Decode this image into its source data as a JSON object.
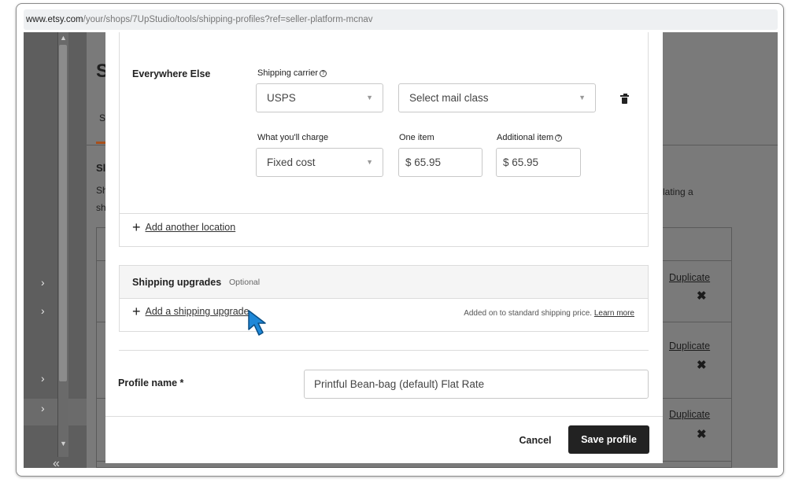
{
  "browser": {
    "url_host": "www.etsy.com",
    "url_path": "/your/shops/7UpStudio/tools/shipping-profiles?ref=seller-platform-mcnav"
  },
  "background": {
    "heading_letter": "S",
    "tab_letter": "S",
    "sub_heading_letter": "Sl",
    "body_letters": [
      "Sh",
      "sh"
    ],
    "trailing_text": "lating a",
    "side_chevrons": [
      "›",
      "›",
      "›",
      "›"
    ],
    "collapse_glyph": "«",
    "row_actions": [
      {
        "duplicate": "Duplicate",
        "remove": "✖"
      },
      {
        "duplicate": "Duplicate",
        "remove": "✖"
      },
      {
        "duplicate": "Duplicate",
        "remove": "✖"
      }
    ]
  },
  "modal": {
    "location": {
      "name": "Everywhere Else",
      "carrier_label": "Shipping carrier",
      "carrier_value": "USPS",
      "mail_class_value": "Select mail class",
      "charge_label": "What you'll charge",
      "charge_value": "Fixed cost",
      "one_item_label": "One item",
      "one_item_value": "$ 65.95",
      "additional_label": "Additional item",
      "additional_value": "$ 65.95",
      "help_glyph": "?"
    },
    "add_location": {
      "plus": "+",
      "label": "Add another location"
    },
    "upgrades": {
      "title": "Shipping upgrades",
      "optional": "Optional",
      "plus": "+",
      "add_label": "Add a shipping upgrade",
      "note": "Added on to standard shipping price.",
      "learn_more": "Learn more"
    },
    "profile": {
      "label": "Profile name *",
      "value": "Printful Bean-bag (default) Flat Rate"
    },
    "buttons": {
      "cancel": "Cancel",
      "save": "Save profile"
    }
  },
  "colors": {
    "accent_orange": "#a8501c",
    "cursor_blue": "#1e88d8",
    "primary_button": "#222222"
  }
}
